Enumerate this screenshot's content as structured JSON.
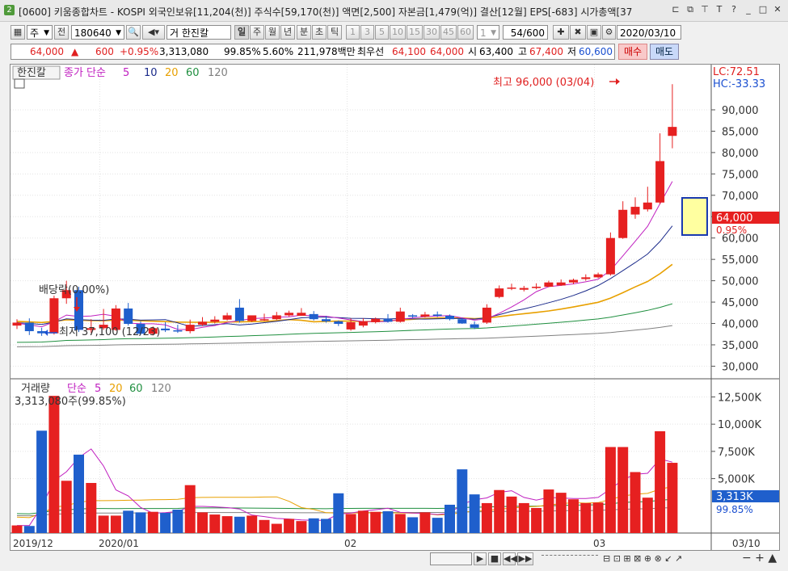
{
  "window": {
    "icon_label": "2",
    "title": "[0600] 키움종합차트 - KOSPI 외국인보유[11,204(천)] 주식수[59,170(천)] 액면[2,500] 자본금[1,479(억)] 결산[12월] EPS[-683] 시가총액[37"
  },
  "toolbar": {
    "market": "주",
    "prev": "전",
    "code": "180640",
    "name_prefix": "거",
    "name": "한진칼",
    "periods": [
      "일",
      "주",
      "월",
      "년",
      "분",
      "초",
      "틱"
    ],
    "intervals": [
      "1",
      "3",
      "5",
      "10",
      "15",
      "30",
      "45",
      "60"
    ],
    "interval_value": "1",
    "count": "54",
    "count_total": "/600",
    "date": "2020/03/10"
  },
  "quote": {
    "price": "64,000",
    "arrow": "▲",
    "change": "600",
    "change_pct": "+0.95%",
    "volume": "3,313,080",
    "vol_ratio": "99.85%",
    "turnover": "5.60%",
    "amount": "211,978백만",
    "best_label": "최우선",
    "best_ask": "64,100",
    "best_bid": "64,000",
    "open_label": "시",
    "open": "63,400",
    "high_label": "고",
    "high": "67,400",
    "low_label": "저",
    "low": "60,600",
    "buy_label": "매수",
    "sell_label": "매도"
  },
  "price_panel": {
    "stock_name": "한진칼",
    "legend_title": "종가 단순",
    "ma_periods": [
      "5",
      "10",
      "20",
      "60",
      "120"
    ],
    "lc": "LC:72.51",
    "hc": "HC:-33.33",
    "high_annotation": "최고 96,000 (03/04)",
    "low_annotation": "최저 37,100 (12/23)",
    "dividend_annotation": "배당락(0.00%)",
    "current_price_label": "64,000",
    "current_pct_label": "0.95%",
    "y_ticks": [
      "90,000",
      "85,000",
      "80,000",
      "75,000",
      "70,000",
      "65,000",
      "60,000",
      "55,000",
      "50,000",
      "45,000",
      "40,000",
      "35,000",
      "30,000"
    ]
  },
  "volume_panel": {
    "legend_title": "거래량",
    "legend_sub": "단순",
    "ma_periods": [
      "5",
      "20",
      "60",
      "120"
    ],
    "volume_label": "3,313,080주(99.85%)",
    "current_label": "3,313K",
    "current_pct": "99.85%",
    "y_ticks": [
      "12,500K",
      "10,000K",
      "7,500K",
      "5,000K"
    ]
  },
  "x_axis": {
    "labels": [
      "2019/12",
      "2020/01",
      "02",
      "03"
    ],
    "corner_label": "03/10"
  },
  "colors": {
    "up": "#e62020",
    "down": "#1f5fcc",
    "ma5": "#c020c0",
    "ma10": "#1a2a8a",
    "ma20": "#e8a000",
    "ma60": "#1f8f3f",
    "ma120": "#808080"
  },
  "chart_data": {
    "type": "candlestick",
    "open": [
      39500,
      40200,
      38200,
      37700,
      45900,
      47800,
      38500,
      38900,
      38500,
      43500,
      39900,
      37600,
      38800,
      38400,
      38200,
      39700,
      40400,
      40900,
      43700,
      40600,
      40900,
      41000,
      41900,
      41800,
      42200,
      41000,
      40500,
      38600,
      39500,
      40300,
      41100,
      40400,
      41900,
      41600,
      42100,
      41800,
      41000,
      39800,
      40200,
      46200,
      48200,
      47900,
      48300,
      48600,
      48900,
      49600,
      50400,
      50800,
      51500,
      60000,
      65500,
      66700,
      68300,
      83900
    ],
    "close": [
      40200,
      38200,
      37700,
      45900,
      47800,
      38500,
      38900,
      39700,
      43500,
      39900,
      37600,
      38900,
      38400,
      38200,
      39700,
      40400,
      40900,
      41900,
      40600,
      41900,
      41000,
      41900,
      42500,
      42500,
      41000,
      40500,
      39900,
      40300,
      40500,
      41100,
      40400,
      42800,
      41600,
      42100,
      41800,
      41000,
      40000,
      39000,
      43700,
      48200,
      48400,
      48300,
      48600,
      49600,
      49600,
      50200,
      50800,
      51500,
      60000,
      66600,
      67300,
      68300,
      78000,
      86000
    ],
    "high": [
      41000,
      41200,
      39000,
      46500,
      50000,
      48600,
      41000,
      43400,
      44300,
      44800,
      40500,
      39300,
      40300,
      39700,
      40900,
      41500,
      41700,
      42500,
      45700,
      41800,
      42300,
      42700,
      43000,
      43600,
      42900,
      41800,
      40700,
      41200,
      41200,
      41400,
      42200,
      43700,
      42200,
      42700,
      42800,
      42100,
      41300,
      40500,
      44500,
      48900,
      49300,
      48800,
      49400,
      50000,
      50300,
      50500,
      51500,
      51900,
      61300,
      68600,
      69500,
      72000,
      84500,
      96000
    ],
    "low": [
      38700,
      37300,
      37100,
      37400,
      44600,
      38000,
      37800,
      38500,
      38300,
      39500,
      37300,
      37200,
      38000,
      37800,
      37700,
      39400,
      40000,
      40700,
      40200,
      40300,
      40600,
      40800,
      41600,
      41800,
      40700,
      40200,
      39400,
      38300,
      39100,
      40000,
      40200,
      40200,
      41300,
      41400,
      41500,
      40700,
      39900,
      38700,
      39900,
      45900,
      47800,
      47500,
      48000,
      48500,
      48800,
      49200,
      50000,
      50600,
      51200,
      59800,
      64500,
      66200,
      67900,
      81000
    ],
    "volume": [
      0.7,
      0.65,
      9.4,
      12.6,
      4.8,
      7.2,
      4.6,
      1.6,
      1.6,
      2.05,
      1.9,
      1.95,
      1.85,
      2.15,
      4.4,
      1.9,
      1.7,
      1.55,
      1.5,
      1.6,
      1.2,
      0.85,
      1.3,
      1.1,
      1.35,
      1.3,
      3.65,
      1.75,
      2.05,
      1.95,
      2.0,
      1.75,
      1.45,
      1.9,
      1.4,
      2.6,
      5.85,
      3.55,
      2.75,
      3.95,
      3.35,
      2.75,
      2.3,
      4.0,
      3.7,
      3.1,
      2.75,
      2.8,
      7.9,
      7.9,
      5.6,
      3.25,
      9.35,
      6.45
    ],
    "ylim": [
      30000,
      96000
    ],
    "volume_unit": "M"
  }
}
